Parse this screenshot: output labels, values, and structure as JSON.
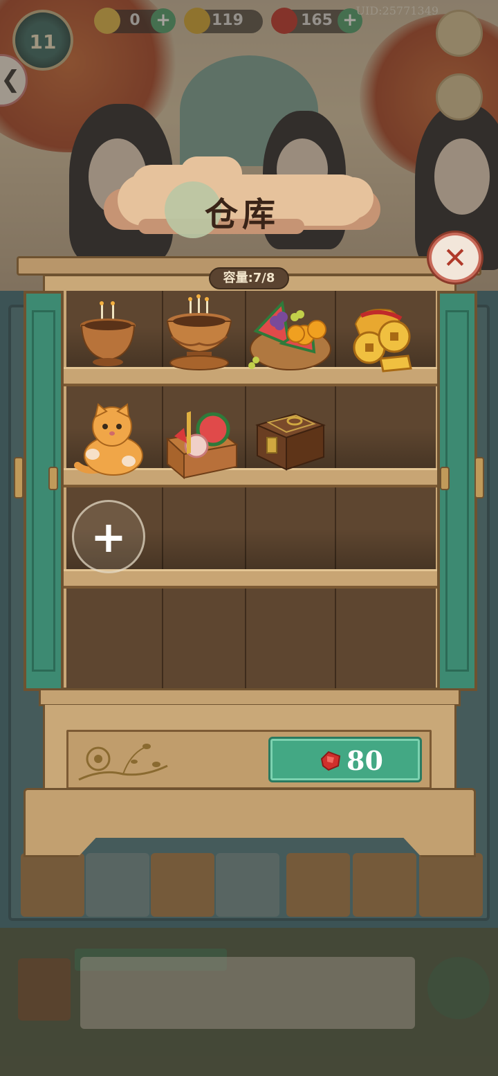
{
  "hud": {
    "level": "11",
    "energy": "0",
    "coins": "119",
    "gems": "165",
    "uid": "UID:25771349"
  },
  "dialog": {
    "title": "仓库",
    "capacity_label": "容量:7/8",
    "add_label": "+",
    "close_label": "✕",
    "purchase_cost": "80"
  },
  "items": [
    {
      "name": "incense-burner-small",
      "shelf": 1
    },
    {
      "name": "lotus-incense-burner",
      "shelf": 1
    },
    {
      "name": "fruit-basket",
      "shelf": 1
    },
    {
      "name": "lucky-coin-pouch",
      "shelf": 1
    },
    {
      "name": "orange-cat",
      "shelf": 2
    },
    {
      "name": "watermelon-gift-crate",
      "shelf": 2
    },
    {
      "name": "treasure-chest",
      "shelf": 2
    }
  ],
  "colors": {
    "door_green": "#3d8a72",
    "buy_button": "#43a884",
    "close_red": "#b03a2a",
    "wood": "#c9a878"
  }
}
